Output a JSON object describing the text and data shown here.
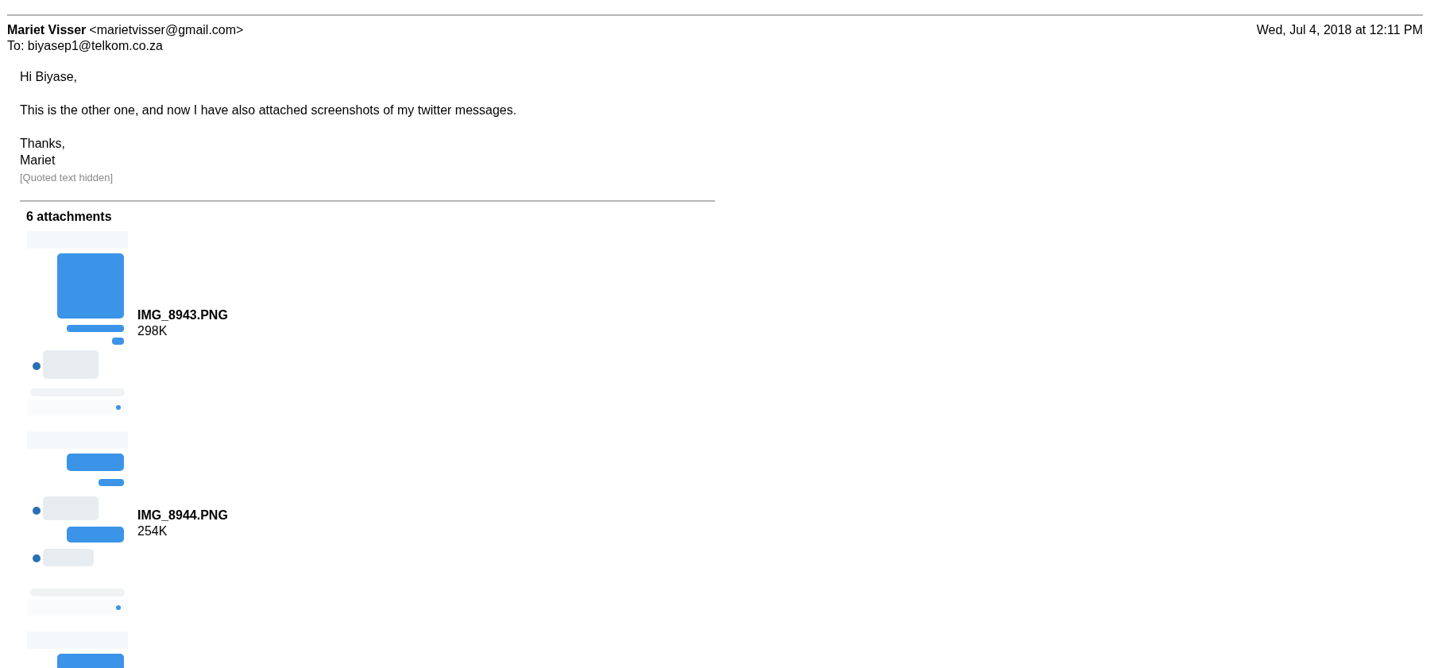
{
  "header": {
    "sender_name": "Mariet Visser",
    "sender_email": "<marietvisser@gmail.com>",
    "date": "Wed, Jul 4, 2018 at 12:11 PM",
    "to": "To: biyasep1@telkom.co.za"
  },
  "body": {
    "greeting": "Hi Biyase,",
    "paragraph": "This is the other one, and now I have also attached screenshots of my twitter messages.",
    "signoff": [
      "Thanks,",
      "Mariet"
    ],
    "quoted": "[Quoted text hidden]"
  },
  "attachments": {
    "title": "6 attachments",
    "items": [
      {
        "kind": "picture",
        "filename": "IMG_8943.PNG",
        "size": "298K"
      },
      {
        "kind": "picture",
        "filename": "IMG_8944.PNG",
        "size": "254K"
      },
      {
        "kind": "picture"
      }
    ]
  }
}
